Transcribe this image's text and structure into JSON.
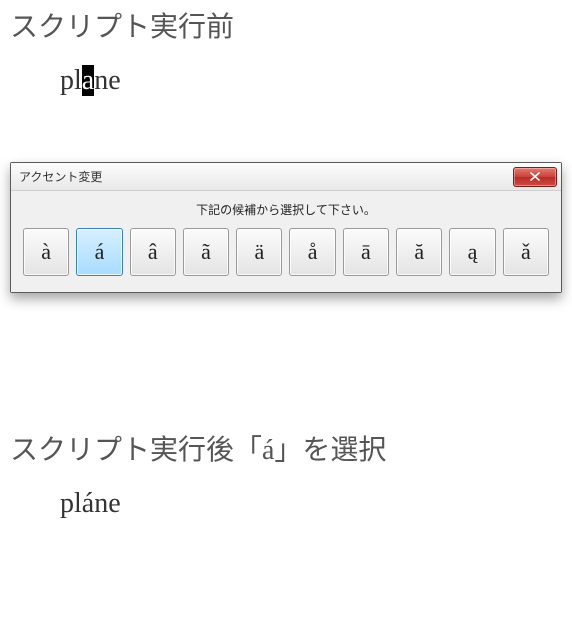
{
  "before": {
    "heading": "スクリプト実行前",
    "word_pre": "pl",
    "word_sel": "a",
    "word_post": "ne"
  },
  "dialog": {
    "title": "アクセント変更",
    "instruction": "下記の候補から選択して下さい。",
    "options": [
      "à",
      "á",
      "â",
      "ã",
      "ä",
      "å",
      "ā",
      "ă",
      "ą",
      "ǎ"
    ],
    "selected_index": 1
  },
  "after": {
    "heading": "スクリプト実行後「á」を選択",
    "word": "pláne"
  }
}
